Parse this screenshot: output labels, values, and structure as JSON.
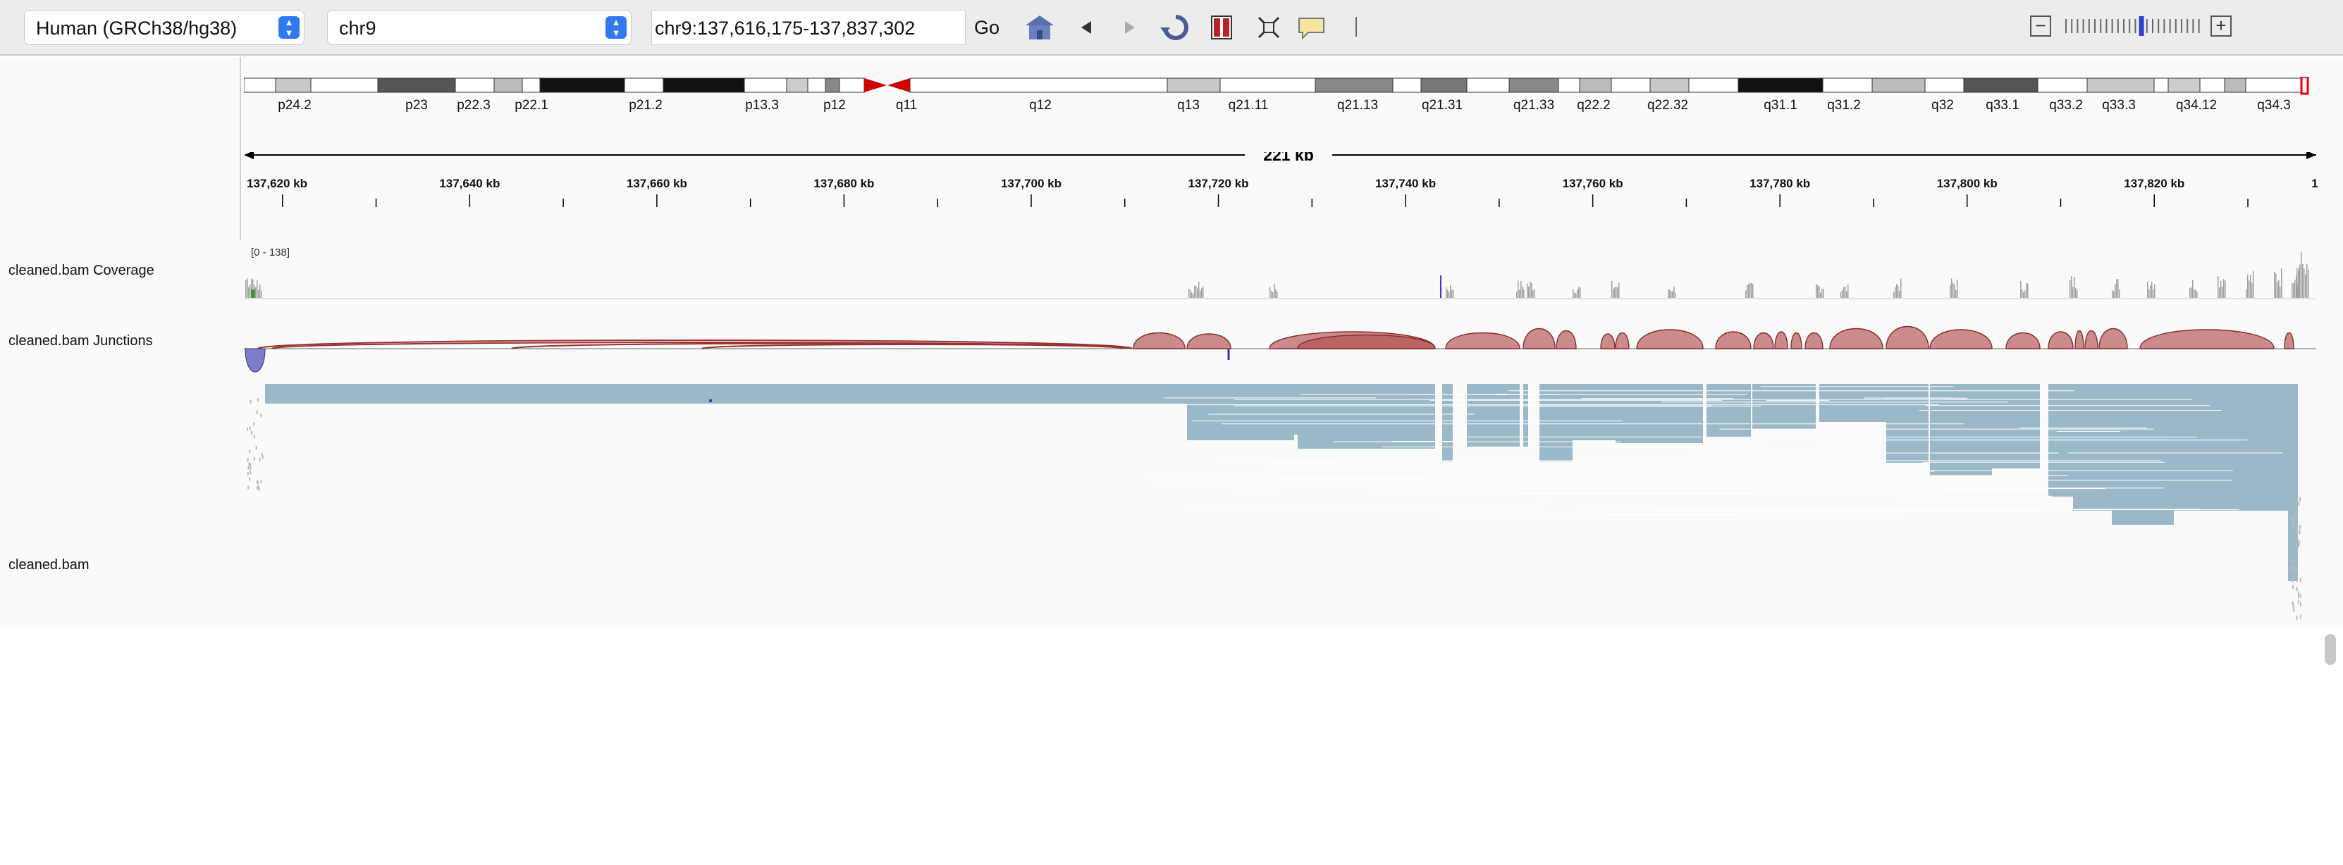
{
  "toolbar": {
    "genome": "Human (GRCh38/hg38)",
    "chromosome": "chr9",
    "locus": "chr9:137,616,175-137,837,302",
    "go_label": "Go",
    "icons": [
      "home-icon",
      "back-icon",
      "forward-icon",
      "refresh-icon",
      "region-of-interest-icon",
      "resize-to-window-icon",
      "popup-text-icon"
    ],
    "zoom_minus": "−",
    "zoom_plus": "+",
    "zoom_level": 0.58
  },
  "ideogram": {
    "bands": [
      "p24.2",
      "p23",
      "p22.3",
      "p22.1",
      "p21.2",
      "p13.3",
      "p12",
      "q11",
      "q12",
      "q13",
      "q21.11",
      "q21.13",
      "q21.31",
      "q21.33",
      "q22.2",
      "q22.32",
      "q31.1",
      "q31.2",
      "q32",
      "q33.1",
      "q33.2",
      "q33.3",
      "q34.12",
      "q34.3"
    ]
  },
  "ruler": {
    "span": "221 kb",
    "ticks": [
      "137,620 kb",
      "137,640 kb",
      "137,660 kb",
      "137,680 kb",
      "137,700 kb",
      "137,720 kb",
      "137,740 kb",
      "137,760 kb",
      "137,780 kb",
      "137,800 kb",
      "137,820 kb",
      "1"
    ]
  },
  "tracks": {
    "coverage_name": "cleaned.bam Coverage",
    "coverage_range": "[0 - 138]",
    "junctions_name": "cleaned.bam Junctions",
    "alignments_name": "cleaned.bam"
  },
  "colors": {
    "junction_plus": "#b35050",
    "junction_minus": "#4848b0",
    "read": "#9ab8c8",
    "coverage": "#a0a0a0"
  }
}
